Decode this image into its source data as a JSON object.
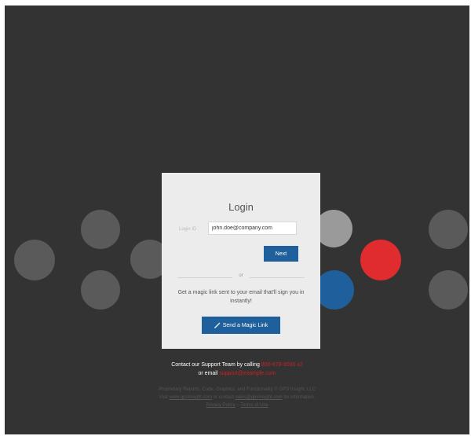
{
  "login": {
    "title": "Login",
    "field_label": "Login ID",
    "input_value": "john.doe@company.com",
    "next_label": "Next",
    "or_text": "or",
    "magic_desc": "Get a magic link sent to your email that'll sign you in instantly!",
    "magic_button_label": "Send a Magic Link",
    "magic_icon": "wand-icon"
  },
  "support": {
    "line1_prefix": "Contact our Support Team by calling",
    "phone": "800-678-9000 x2",
    "line2_prefix": "or email",
    "email": "support@example.com"
  },
  "legal": {
    "line1": "Proprietary Reports, Code, Graphics, and Functionality © GPS Insight, LLC",
    "line2_prefix": "Visit",
    "site_link": "www.gpsinsight.com",
    "line2_mid": "or contact",
    "contact_link": "sales@gpsinsight.com",
    "line2_suffix": "for information.",
    "privacy_link": "Privacy Policy",
    "separator": "–",
    "terms_link": "Terms of Use"
  },
  "colors": {
    "background": "#333333",
    "card": "#ececec",
    "accent_blue": "#1f5f9c",
    "accent_red": "#e02b2f",
    "dot_gray": "#5a5a5a",
    "dot_light": "#9a9a9a"
  }
}
